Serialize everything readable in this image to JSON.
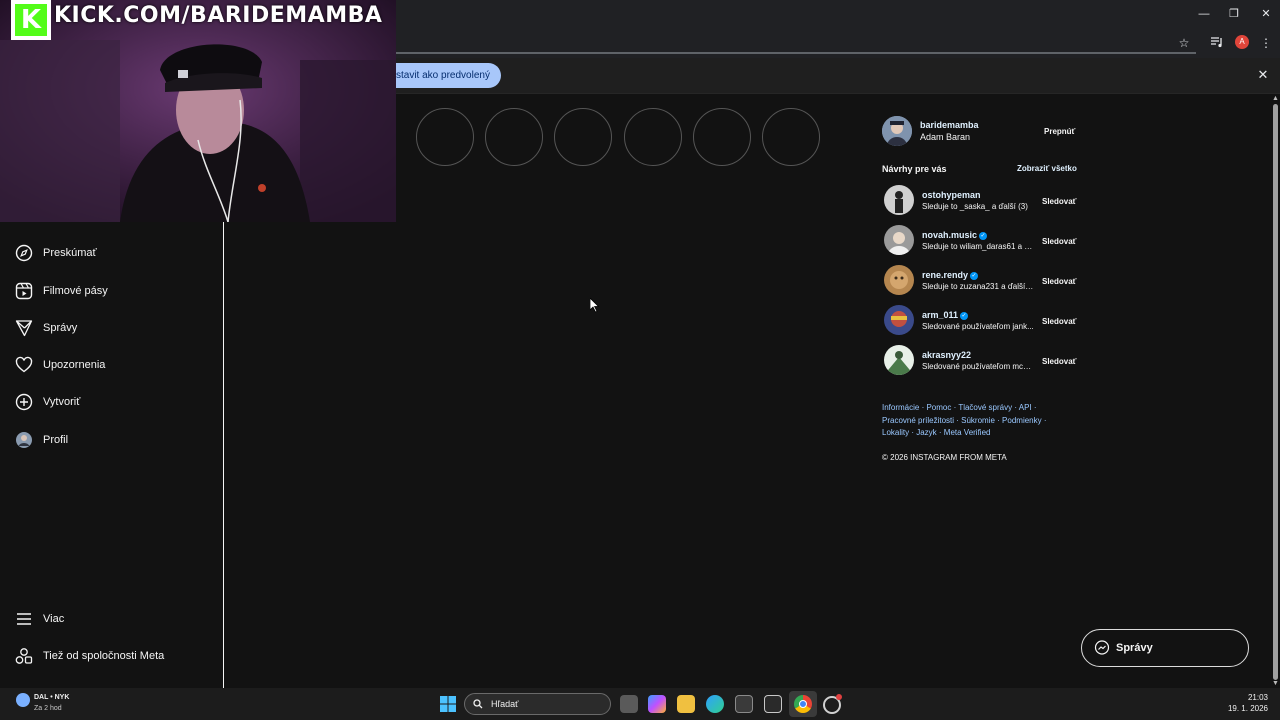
{
  "stream_overlay": {
    "logo_letter": "K",
    "url_text": "KICK.COM/BARIDEMAMBA"
  },
  "window_controls": {
    "minimize": "—",
    "maximize": "❐",
    "close": "✕"
  },
  "browser": {
    "infobar_button": "stavit ako predvolený",
    "infobar_close": "✕",
    "profile_initial": "A"
  },
  "sidebar": {
    "items": [
      {
        "label": "Preskúmať",
        "icon": "compass-icon"
      },
      {
        "label": "Filmové pásy",
        "icon": "reels-icon"
      },
      {
        "label": "Správy",
        "icon": "send-icon"
      },
      {
        "label": "Upozornenia",
        "icon": "heart-icon"
      },
      {
        "label": "Vytvoriť",
        "icon": "plus-square-icon"
      },
      {
        "label": "Profil",
        "icon": "avatar"
      }
    ],
    "bottom_items": [
      {
        "label": "Viac",
        "icon": "menu-icon"
      },
      {
        "label": "Tiež od spoločnosti Meta",
        "icon": "meta-icon"
      }
    ]
  },
  "current_user": {
    "username": "baridemamba",
    "full_name": "Adam Baran",
    "switch_label": "Prepnúť"
  },
  "suggestions": {
    "title": "Návrhy pre vás",
    "see_all": "Zobraziť všetko",
    "items": [
      {
        "username": "ostohypeman",
        "verified": false,
        "subtitle": "Sleduje to _saska_ a ďalší (3)",
        "action": "Sledovať",
        "color": "#2a2a2a"
      },
      {
        "username": "novah.music",
        "verified": true,
        "subtitle": "Sleduje to wiliam_daras61 a ď...",
        "action": "Sledovať",
        "color": "#8a8a8a"
      },
      {
        "username": "rene.rendy",
        "verified": true,
        "subtitle": "Sleduje to zuzana231 a ďalší (...",
        "action": "Sledovať",
        "color": "#b07a4a"
      },
      {
        "username": "arm_011",
        "verified": true,
        "subtitle": "Sledované používateľom jank...",
        "action": "Sledovať",
        "color": "#c04040"
      },
      {
        "username": "akrasnyy22",
        "verified": false,
        "subtitle": "Sledované používateľom mc_...",
        "action": "Sledovať",
        "color": "#5a8a5a"
      }
    ]
  },
  "footer": {
    "line1": "Informácie · Pomoc · Tlačové správy · API ·",
    "line2": "Pracovné príležitosti · Súkromie · Podmienky ·",
    "line3": "Lokality · Jazyk · Meta Verified",
    "copyright": "© 2026 INSTAGRAM FROM META"
  },
  "messages_button": {
    "label": "Správy"
  },
  "taskbar": {
    "weather_title": "DAL • NYK",
    "weather_sub": "Za 2 hod",
    "search_placeholder": "Hľadať",
    "time": "21:03",
    "date": "19. 1. 2026"
  }
}
